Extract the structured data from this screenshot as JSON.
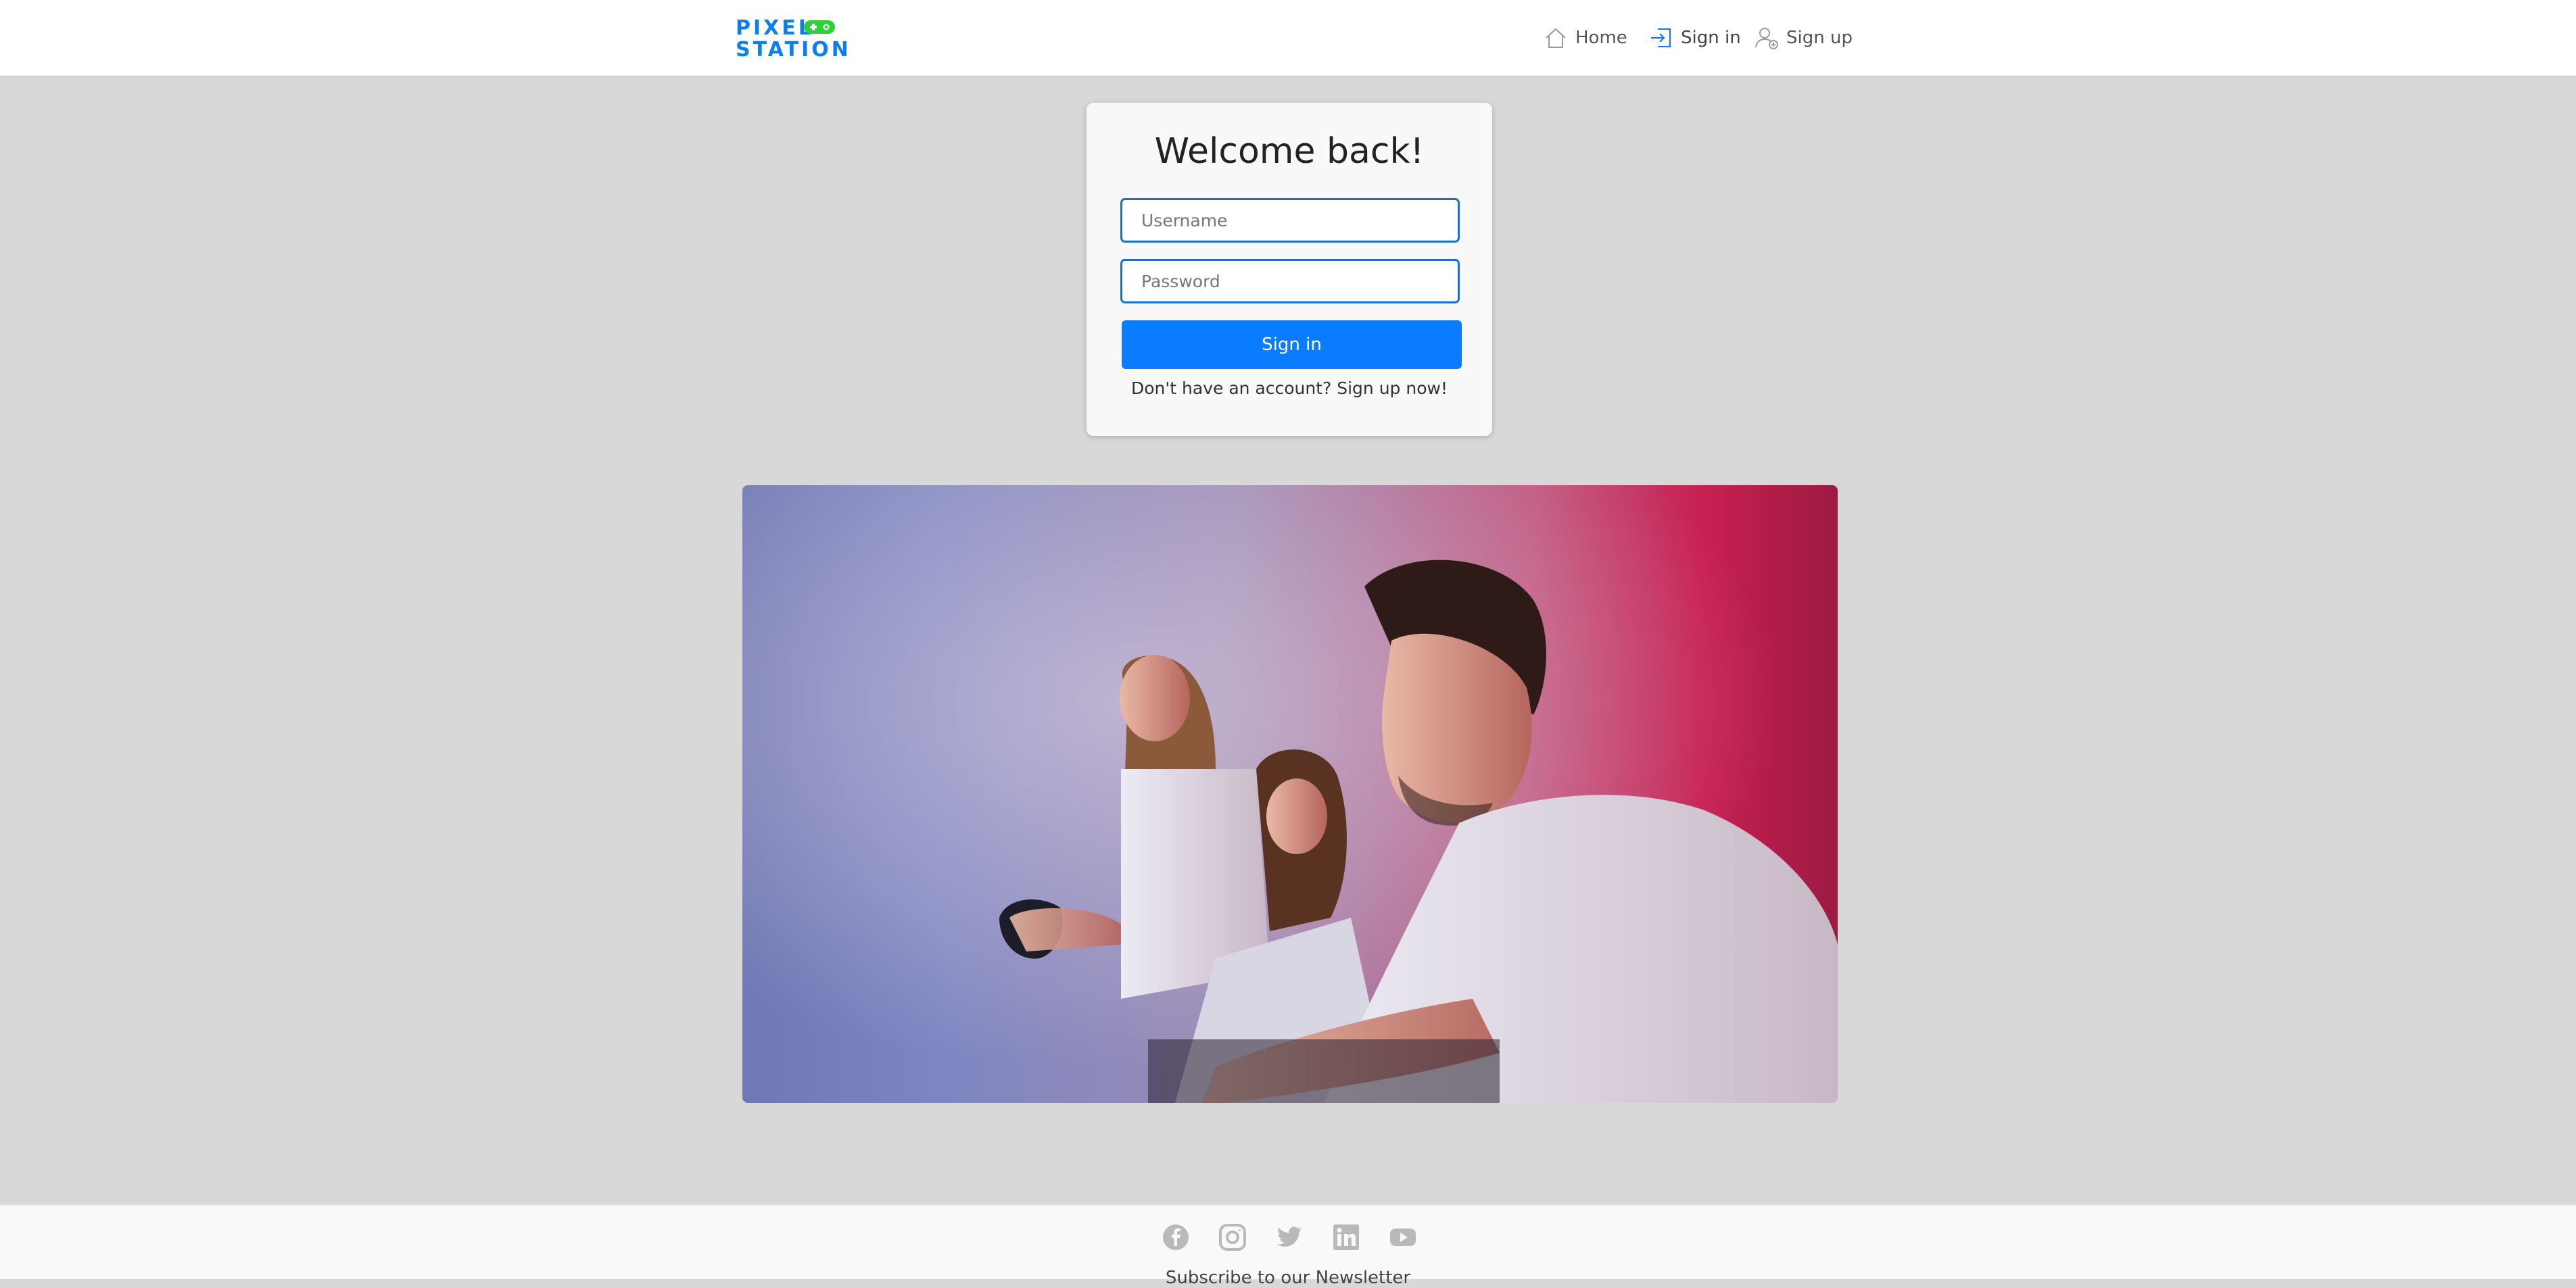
{
  "brand": {
    "line1": "PIXEL",
    "line2": "STATION",
    "accent": "#0d7ef0",
    "pad_color": "#2fd13a"
  },
  "nav": {
    "home": {
      "label": "Home",
      "icon": "home-icon"
    },
    "signin": {
      "label": "Sign in",
      "icon": "sign-in-icon"
    },
    "signup": {
      "label": "Sign up",
      "icon": "add-user-icon"
    }
  },
  "login": {
    "title": "Welcome back!",
    "username_placeholder": "Username",
    "password_placeholder": "Password",
    "submit_label": "Sign in",
    "signup_prompt": "Don't have an account? Sign up now!",
    "button_color": "#0a7cff",
    "field_border_color": "#1a6fd6"
  },
  "hero": {
    "description_icon": "photo-gaming-family"
  },
  "footer": {
    "social": [
      {
        "icon": "facebook-icon"
      },
      {
        "icon": "instagram-icon"
      },
      {
        "icon": "twitter-icon"
      },
      {
        "icon": "linkedin-icon"
      },
      {
        "icon": "youtube-icon"
      }
    ],
    "newsletter_text": "Subscribe to our Newsletter"
  }
}
